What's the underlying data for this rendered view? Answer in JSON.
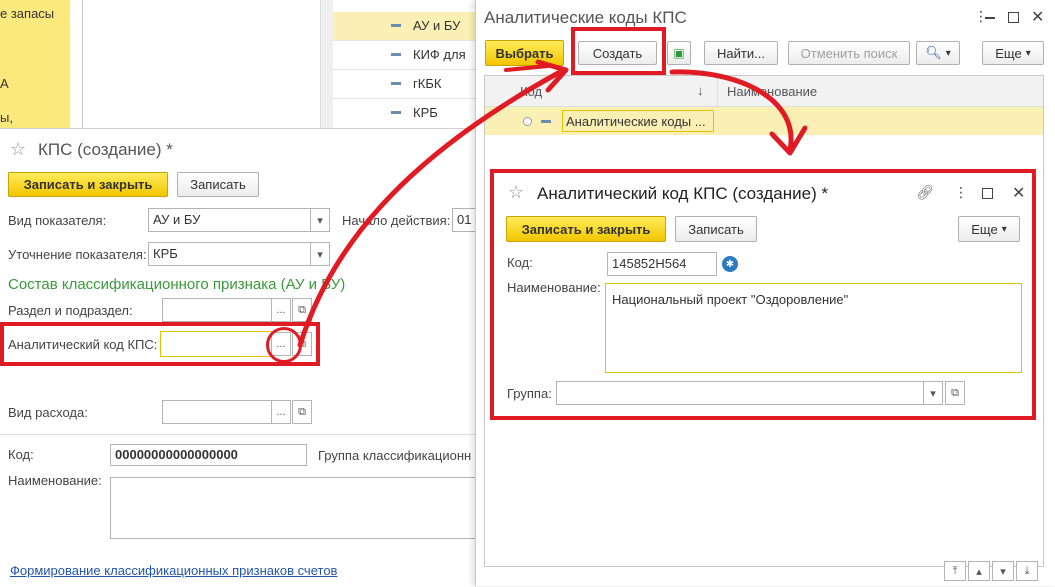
{
  "bg_list": {
    "left_strip": [
      "е запасы",
      "А",
      "ы,"
    ],
    "rows": [
      {
        "label": "АУ и БУ",
        "selected": true
      },
      {
        "label": "КИФ для",
        "selected": false
      },
      {
        "label": "гКБК",
        "selected": false
      },
      {
        "label": "КРБ",
        "selected": false
      }
    ]
  },
  "kps_form": {
    "title": "КПС (создание) *",
    "save_close": "Записать и закрыть",
    "save": "Записать",
    "vid_label": "Вид показателя:",
    "vid_value": "АУ и БУ",
    "start_label": "Начало действия:",
    "start_value": "01",
    "utoch_label": "Уточнение показателя:",
    "utoch_value": "КРБ",
    "section_title": "Состав классификационного признака (АУ и БУ)",
    "razdel_label": "Раздел и подраздел:",
    "analit_label": "Аналитический код КПС:",
    "vid_rashoda_label": "Вид расхода:",
    "kod_label": "Код:",
    "kod_value": "00000000000000000",
    "gruppa_label": "Группа классификационн",
    "name_label": "Наименование:",
    "link": "Формирование классификационных признаков счетов",
    "ellipsis": "..."
  },
  "codes_list": {
    "title": "Аналитические коды КПС",
    "select": "Выбрать",
    "create": "Создать",
    "find": "Найти...",
    "cancel_search": "Отменить поиск",
    "more": "Еще",
    "col_code": "Код",
    "col_name": "Наименование",
    "sort_glyph": "↓",
    "row_name": "Аналитические коды ..."
  },
  "new_code_form": {
    "title": "Аналитический код КПС (создание) *",
    "save_close": "Записать и закрыть",
    "save": "Записать",
    "more": "Еще",
    "kod_label": "Код:",
    "kod_value": "145852Н564",
    "name_label": "Наименование:",
    "name_value": "Национальный проект \"Оздоровление\"",
    "group_label": "Группа:"
  },
  "colors": {
    "accent_yellow": "#f5d20a",
    "annotation_red": "#e01b24",
    "section_green": "#3a9a3a",
    "link_blue": "#2255aa"
  }
}
